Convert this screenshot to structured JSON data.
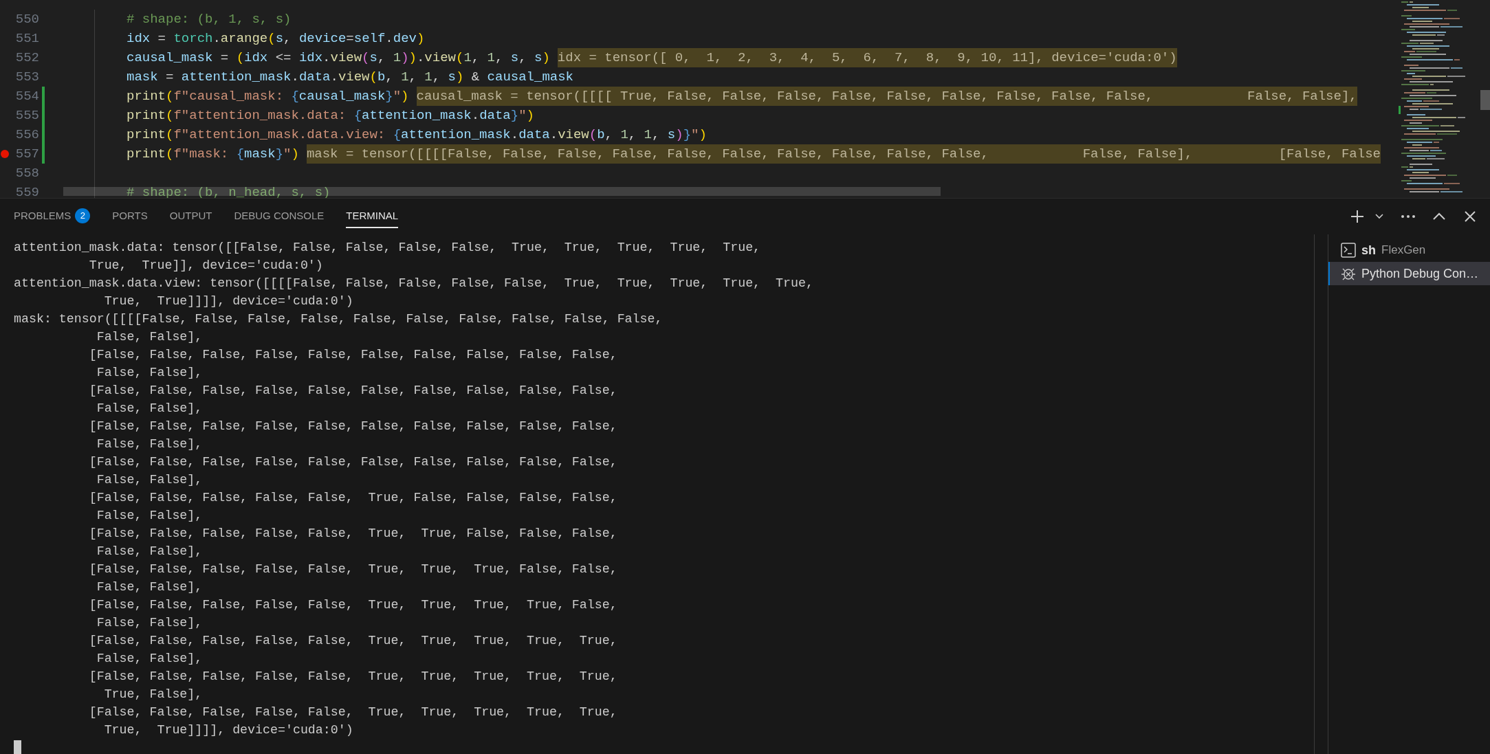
{
  "editor": {
    "lines": [
      {
        "number": "550",
        "modified": false,
        "breakpoint": false,
        "tokens": [
          {
            "text": "# shape: (b, 1, s, s)",
            "kind": "comment"
          }
        ]
      },
      {
        "number": "551",
        "modified": false,
        "breakpoint": false,
        "tokens": [
          {
            "text": "idx",
            "kind": "var"
          },
          {
            "text": " = ",
            "kind": "plain"
          },
          {
            "text": "torch",
            "kind": "class"
          },
          {
            "text": ".",
            "kind": "plain"
          },
          {
            "text": "arange",
            "kind": "func"
          },
          {
            "text": "(",
            "kind": "brace1"
          },
          {
            "text": "s",
            "kind": "var"
          },
          {
            "text": ", ",
            "kind": "plain"
          },
          {
            "text": "device",
            "kind": "var"
          },
          {
            "text": "=",
            "kind": "plain"
          },
          {
            "text": "self",
            "kind": "var"
          },
          {
            "text": ".",
            "kind": "plain"
          },
          {
            "text": "dev",
            "kind": "var"
          },
          {
            "text": ")",
            "kind": "brace1"
          }
        ]
      },
      {
        "number": "552",
        "modified": false,
        "breakpoint": false,
        "tokens": [
          {
            "text": "causal_mask",
            "kind": "var"
          },
          {
            "text": " = ",
            "kind": "plain"
          },
          {
            "text": "(",
            "kind": "brace1"
          },
          {
            "text": "idx",
            "kind": "var"
          },
          {
            "text": " <= ",
            "kind": "plain"
          },
          {
            "text": "idx",
            "kind": "var"
          },
          {
            "text": ".",
            "kind": "plain"
          },
          {
            "text": "view",
            "kind": "func"
          },
          {
            "text": "(",
            "kind": "brace2"
          },
          {
            "text": "s",
            "kind": "var"
          },
          {
            "text": ", ",
            "kind": "plain"
          },
          {
            "text": "1",
            "kind": "num"
          },
          {
            "text": ")",
            "kind": "brace2"
          },
          {
            "text": ")",
            "kind": "brace1"
          },
          {
            "text": ".",
            "kind": "plain"
          },
          {
            "text": "view",
            "kind": "func"
          },
          {
            "text": "(",
            "kind": "brace1"
          },
          {
            "text": "1",
            "kind": "num"
          },
          {
            "text": ", ",
            "kind": "plain"
          },
          {
            "text": "1",
            "kind": "num"
          },
          {
            "text": ", ",
            "kind": "plain"
          },
          {
            "text": "s",
            "kind": "var"
          },
          {
            "text": ", ",
            "kind": "plain"
          },
          {
            "text": "s",
            "kind": "var"
          },
          {
            "text": ")",
            "kind": "brace1"
          }
        ],
        "inline_value": "idx = tensor([ 0,  1,  2,  3,  4,  5,  6,  7,  8,  9, 10, 11], device='cuda:0')"
      },
      {
        "number": "553",
        "modified": false,
        "breakpoint": false,
        "tokens": [
          {
            "text": "mask",
            "kind": "var"
          },
          {
            "text": " = ",
            "kind": "plain"
          },
          {
            "text": "attention_mask",
            "kind": "var"
          },
          {
            "text": ".",
            "kind": "plain"
          },
          {
            "text": "data",
            "kind": "var"
          },
          {
            "text": ".",
            "kind": "plain"
          },
          {
            "text": "view",
            "kind": "func"
          },
          {
            "text": "(",
            "kind": "brace1"
          },
          {
            "text": "b",
            "kind": "var"
          },
          {
            "text": ", ",
            "kind": "plain"
          },
          {
            "text": "1",
            "kind": "num"
          },
          {
            "text": ", ",
            "kind": "plain"
          },
          {
            "text": "1",
            "kind": "num"
          },
          {
            "text": ", ",
            "kind": "plain"
          },
          {
            "text": "s",
            "kind": "var"
          },
          {
            "text": ")",
            "kind": "brace1"
          },
          {
            "text": " & ",
            "kind": "plain"
          },
          {
            "text": "causal_mask",
            "kind": "var"
          }
        ]
      },
      {
        "number": "554",
        "modified": true,
        "breakpoint": false,
        "tokens": [
          {
            "text": "print",
            "kind": "func"
          },
          {
            "text": "(",
            "kind": "brace1"
          },
          {
            "text": "f\"causal_mask: ",
            "kind": "str"
          },
          {
            "text": "{",
            "kind": "brace3"
          },
          {
            "text": "causal_mask",
            "kind": "var"
          },
          {
            "text": "}",
            "kind": "brace3"
          },
          {
            "text": "\"",
            "kind": "str"
          },
          {
            "text": ")",
            "kind": "brace1"
          }
        ],
        "inline_value": "causal_mask = tensor([[[[ True, False, False, False, False, False, False, False, False, False,            False, False],"
      },
      {
        "number": "555",
        "modified": true,
        "breakpoint": false,
        "tokens": [
          {
            "text": "print",
            "kind": "func"
          },
          {
            "text": "(",
            "kind": "brace1"
          },
          {
            "text": "f\"attention_mask.data: ",
            "kind": "str"
          },
          {
            "text": "{",
            "kind": "brace3"
          },
          {
            "text": "attention_mask",
            "kind": "var"
          },
          {
            "text": ".",
            "kind": "plain"
          },
          {
            "text": "data",
            "kind": "var"
          },
          {
            "text": "}",
            "kind": "brace3"
          },
          {
            "text": "\"",
            "kind": "str"
          },
          {
            "text": ")",
            "kind": "brace1"
          }
        ]
      },
      {
        "number": "556",
        "modified": true,
        "breakpoint": false,
        "tokens": [
          {
            "text": "print",
            "kind": "func"
          },
          {
            "text": "(",
            "kind": "brace1"
          },
          {
            "text": "f\"attention_mask.data.view: ",
            "kind": "str"
          },
          {
            "text": "{",
            "kind": "brace3"
          },
          {
            "text": "attention_mask",
            "kind": "var"
          },
          {
            "text": ".",
            "kind": "plain"
          },
          {
            "text": "data",
            "kind": "var"
          },
          {
            "text": ".",
            "kind": "plain"
          },
          {
            "text": "view",
            "kind": "func"
          },
          {
            "text": "(",
            "kind": "brace2"
          },
          {
            "text": "b",
            "kind": "var"
          },
          {
            "text": ", ",
            "kind": "plain"
          },
          {
            "text": "1",
            "kind": "num"
          },
          {
            "text": ", ",
            "kind": "plain"
          },
          {
            "text": "1",
            "kind": "num"
          },
          {
            "text": ", ",
            "kind": "plain"
          },
          {
            "text": "s",
            "kind": "var"
          },
          {
            "text": ")",
            "kind": "brace2"
          },
          {
            "text": "}",
            "kind": "brace3"
          },
          {
            "text": "\"",
            "kind": "str"
          },
          {
            "text": ")",
            "kind": "brace1"
          }
        ]
      },
      {
        "number": "557",
        "modified": true,
        "breakpoint": true,
        "tokens": [
          {
            "text": "print",
            "kind": "func"
          },
          {
            "text": "(",
            "kind": "brace1"
          },
          {
            "text": "f\"mask: ",
            "kind": "str"
          },
          {
            "text": "{",
            "kind": "brace3"
          },
          {
            "text": "mask",
            "kind": "var"
          },
          {
            "text": "}",
            "kind": "brace3"
          },
          {
            "text": "\"",
            "kind": "str"
          },
          {
            "text": ")",
            "kind": "brace1"
          }
        ],
        "inline_value": "mask = tensor([[[[False, False, False, False, False, False, False, False, False, False,            False, False],           [False, False"
      },
      {
        "number": "558",
        "modified": false,
        "breakpoint": false
      },
      {
        "number": "559",
        "modified": false,
        "breakpoint": false,
        "tokens": [
          {
            "text": "# shape: (b, n_head, s, s)",
            "kind": "comment"
          }
        ]
      }
    ]
  },
  "panel": {
    "tabs": [
      {
        "label": "PROBLEMS",
        "badge": "2",
        "selected": false
      },
      {
        "label": "PORTS",
        "selected": false
      },
      {
        "label": "OUTPUT",
        "selected": false
      },
      {
        "label": "DEBUG CONSOLE",
        "selected": false
      },
      {
        "label": "TERMINAL",
        "selected": true
      }
    ],
    "terminal_lines": [
      "attention_mask.data: tensor([[False, False, False, False, False,  True,  True,  True,  True,  True,",
      "          True,  True]], device='cuda:0')",
      "attention_mask.data.view: tensor([[[[False, False, False, False, False,  True,  True,  True,  True,  True,",
      "            True,  True]]]], device='cuda:0')",
      "mask: tensor([[[[False, False, False, False, False, False, False, False, False, False,",
      "           False, False],",
      "          [False, False, False, False, False, False, False, False, False, False,",
      "           False, False],",
      "          [False, False, False, False, False, False, False, False, False, False,",
      "           False, False],",
      "          [False, False, False, False, False, False, False, False, False, False,",
      "           False, False],",
      "          [False, False, False, False, False, False, False, False, False, False,",
      "           False, False],",
      "          [False, False, False, False, False,  True, False, False, False, False,",
      "           False, False],",
      "          [False, False, False, False, False,  True,  True, False, False, False,",
      "           False, False],",
      "          [False, False, False, False, False,  True,  True,  True, False, False,",
      "           False, False],",
      "          [False, False, False, False, False,  True,  True,  True,  True, False,",
      "           False, False],",
      "          [False, False, False, False, False,  True,  True,  True,  True,  True,",
      "           False, False],",
      "          [False, False, False, False, False,  True,  True,  True,  True,  True,",
      "            True, False],",
      "          [False, False, False, False, False,  True,  True,  True,  True,  True,",
      "            True,  True]]]], device='cuda:0')"
    ],
    "terminals": [
      {
        "kind": "shell",
        "name": "sh",
        "folder": "FlexGen",
        "selected": false
      },
      {
        "kind": "debug",
        "name": "Python Debug Con…",
        "selected": true
      }
    ]
  }
}
